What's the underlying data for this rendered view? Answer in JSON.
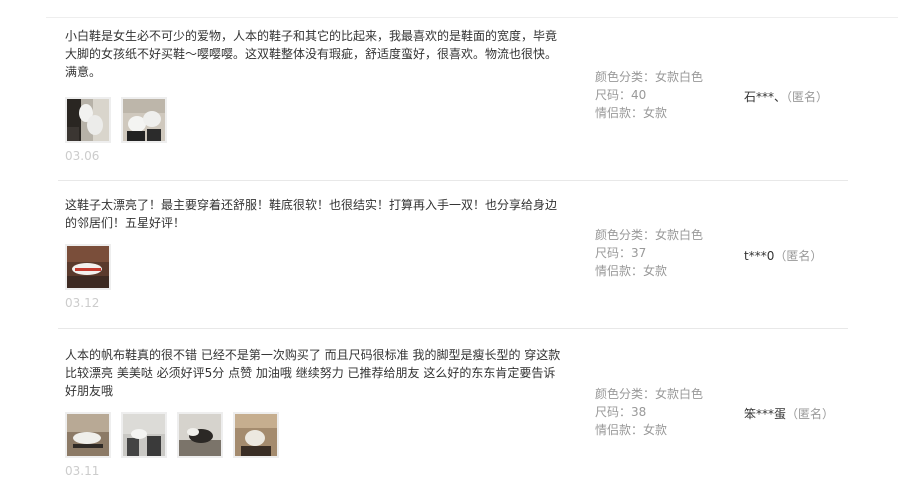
{
  "reviews": [
    {
      "text": "小白鞋是女生必不可少的爱物，人本的鞋子和其它的比起来，我最喜欢的是鞋面的宽度，毕竟大脚的女孩纸不好买鞋～嘤嘤嘤。这双鞋整体没有瑕疵，舒适度蛮好，很喜欢。物流也很快。满意。",
      "date": "03.06",
      "color_label": "颜色分类：",
      "color_value": "女款白色",
      "size_label": "尺码：",
      "size_value": "40",
      "couple_label": "情侣款：",
      "couple_value": "女款",
      "user": "石***、",
      "anon": "（匿名）",
      "photos": [
        "shoe-photo-1",
        "shoe-photo-2"
      ]
    },
    {
      "text": "这鞋子太漂亮了！最主要穿着还舒服！鞋底很软！也很结实！打算再入手一双！也分享给身边的邻居们！五星好评！",
      "date": "03.12",
      "color_label": "颜色分类：",
      "color_value": "女款白色",
      "size_label": "尺码：",
      "size_value": "37",
      "couple_label": "情侣款：",
      "couple_value": "女款",
      "user": "t***0",
      "anon": "（匿名）",
      "photos": [
        "shoe-photo-1"
      ]
    },
    {
      "text": "人本的帆布鞋真的很不错 已经不是第一次购买了 而且尺码很标准 我的脚型是瘦长型的 穿这款比较漂亮 美美哒 必须好评5分 点赞 加油哦 继续努力 已推荐给朋友 这么好的东东肯定要告诉好朋友哦",
      "date": "03.11",
      "color_label": "颜色分类：",
      "color_value": "女款白色",
      "size_label": "尺码：",
      "size_value": "38",
      "couple_label": "情侣款：",
      "couple_value": "女款",
      "user": "笨***蛋",
      "anon": "（匿名）",
      "photos": [
        "shoe-photo-1",
        "shoe-photo-2",
        "shoe-photo-3",
        "shoe-photo-4"
      ]
    }
  ]
}
